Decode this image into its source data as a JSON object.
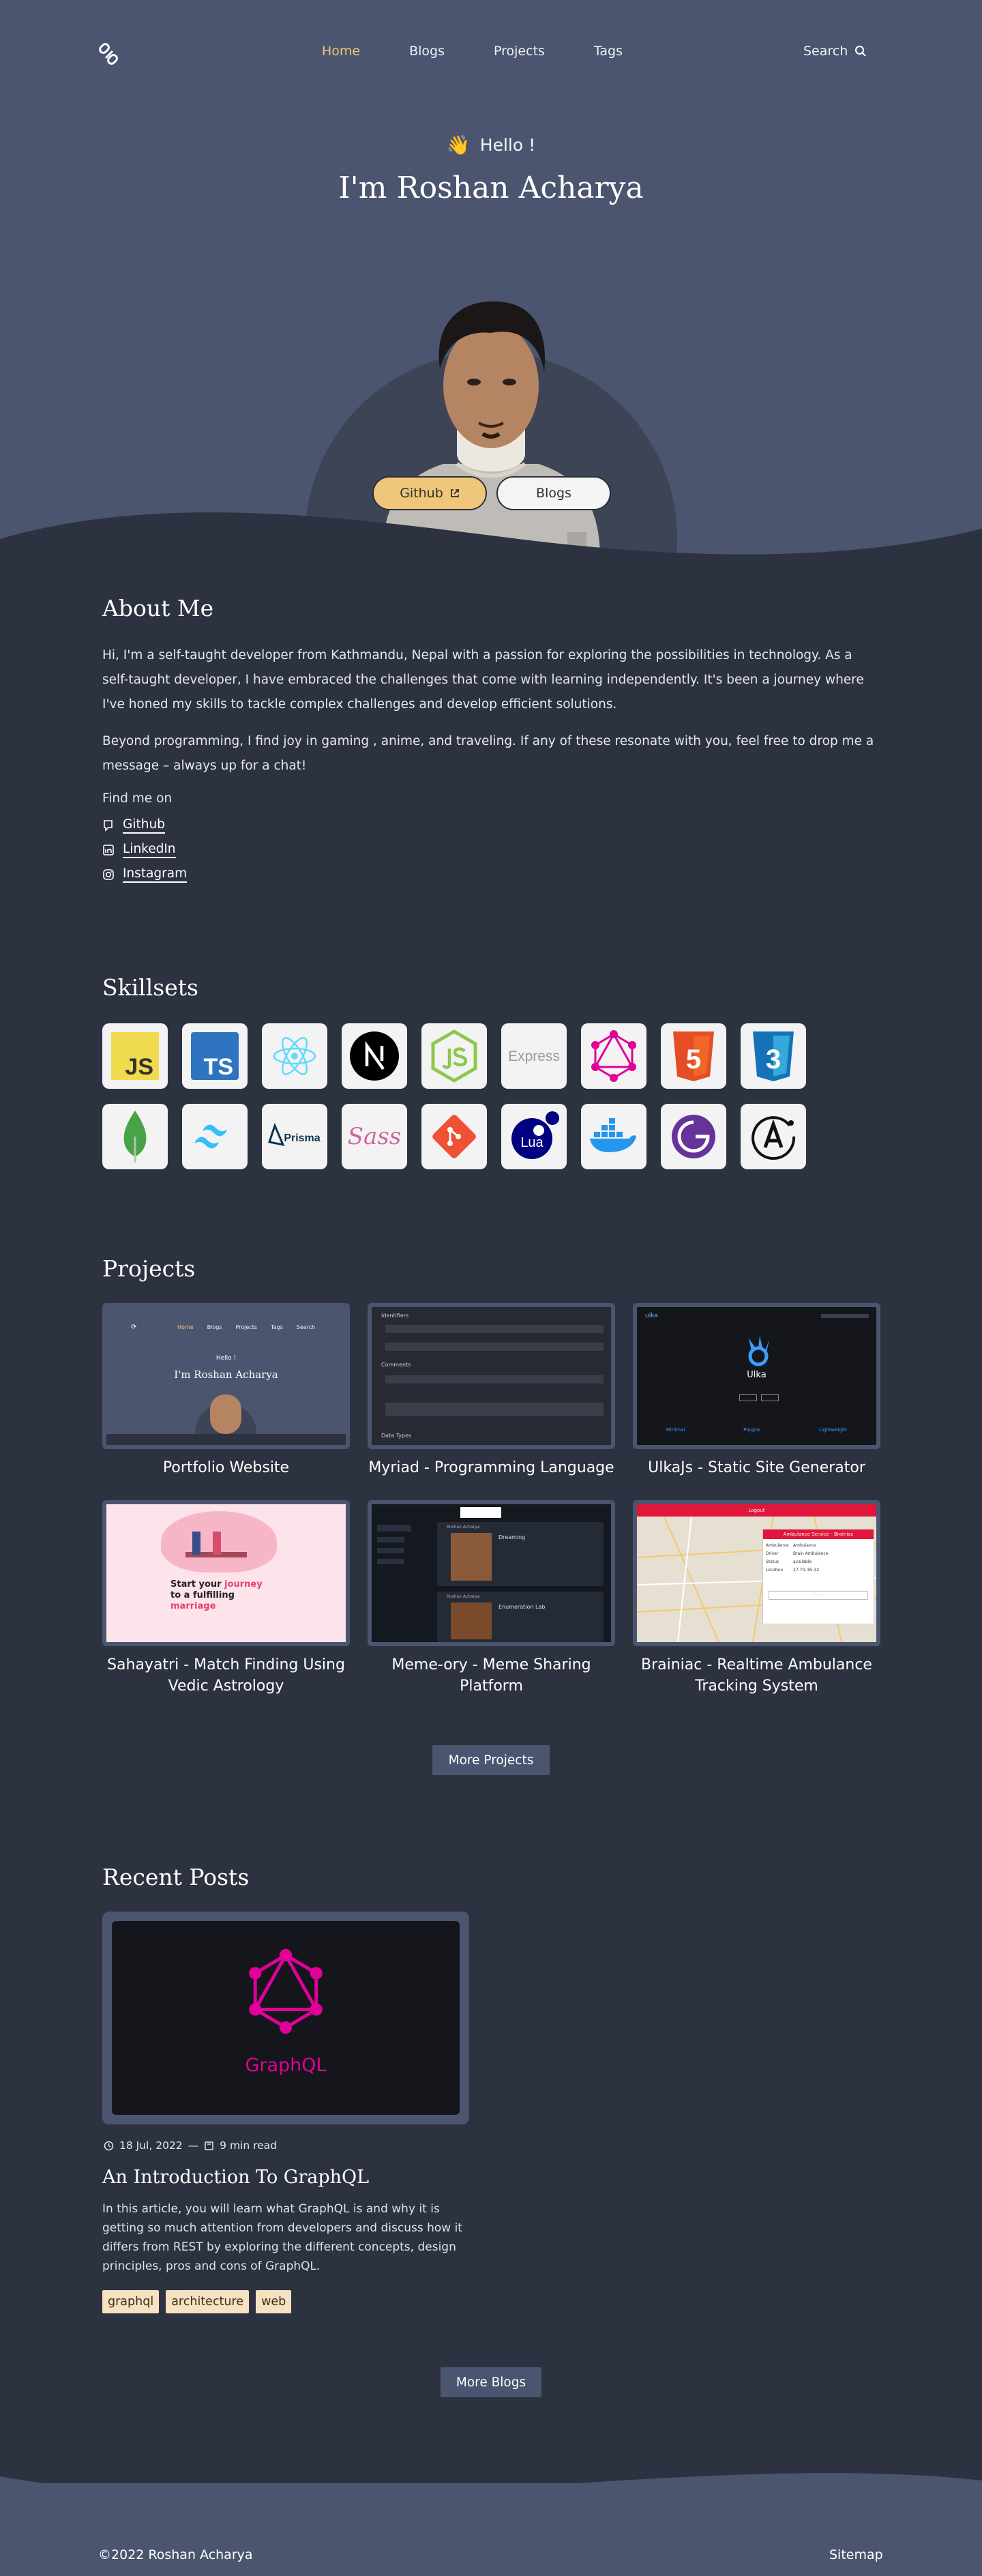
{
  "nav": {
    "links": [
      {
        "label": "Home",
        "active": true
      },
      {
        "label": "Blogs",
        "active": false
      },
      {
        "label": "Projects",
        "active": false
      },
      {
        "label": "Tags",
        "active": false
      }
    ],
    "search_label": "Search",
    "logo_icon": "link-logo-icon"
  },
  "hero": {
    "greeting_emoji": "👋",
    "greeting": "Hello !",
    "name": "I'm Roshan Acharya",
    "github_label": "Github",
    "blogs_label": "Blogs",
    "accent_color": "#f0c67a"
  },
  "about": {
    "title": "About Me",
    "paragraphs": [
      "Hi, I'm a self-taught developer from Kathmandu, Nepal with a passion for exploring the possibilities in technology. As a self-taught developer, I have embraced the challenges that come with learning independently. It's been a journey where I've honed my skills to tackle complex challenges and develop efficient solutions.",
      "Beyond programming, I find joy in gaming , anime, and traveling. If any of these resonate with you, feel free to drop me a message – always up for a chat!"
    ],
    "find_me": "Find me on",
    "socials": [
      {
        "label": "Github",
        "icon": "github-icon"
      },
      {
        "label": "LinkedIn",
        "icon": "linkedin-icon"
      },
      {
        "label": "Instagram",
        "icon": "instagram-icon"
      }
    ]
  },
  "skills": {
    "title": "Skillsets",
    "items": [
      "javascript",
      "typescript",
      "react",
      "nextjs",
      "nodejs",
      "express",
      "graphql",
      "html5",
      "css3",
      "mongodb",
      "tailwindcss",
      "prisma",
      "sass",
      "git",
      "lua",
      "docker",
      "gatsby",
      "apollo"
    ],
    "labels": {
      "js": "JS",
      "ts": "TS",
      "express": "Express",
      "prisma": "Prisma",
      "sass": "Sass",
      "lua": "Lua",
      "html": "5",
      "css": "3"
    }
  },
  "projects": {
    "title": "Projects",
    "items": [
      {
        "title": "Portfolio Website"
      },
      {
        "title": "Myriad - Programming Language"
      },
      {
        "title": "UlkaJs - Static Site Generator"
      },
      {
        "title": "Sahayatri - Match Finding Using Vedic Astrology"
      },
      {
        "title": "Meme-ory - Meme Sharing Platform"
      },
      {
        "title": "Brainiac - Realtime Ambulance Tracking System"
      }
    ],
    "thumb_text": {
      "portfolio_nav": [
        "Home",
        "Blogs",
        "Projects",
        "Tags",
        "Search"
      ],
      "portfolio_hello": "Hello !",
      "portfolio_name": "I'm Roshan Acharya",
      "myriad_headings": [
        "Identifiers",
        "Comments",
        "Data Types"
      ],
      "ulka_name": "Ulka",
      "ulka_logo": "ulka",
      "ulka_features": [
        "Minimal",
        "Plugins",
        "Lightweight"
      ],
      "sahayatri_line1": "Start your",
      "sahayatri_highlight": "journey",
      "sahayatri_line2": "to a fulfilling",
      "sahayatri_line3": "marriage",
      "memeory_user": "Roshan Acharya",
      "memeory_caption": "Dreaming",
      "memeory_user2": "Enumeration Lab",
      "brainiac_header": "Logout",
      "brainiac_panel_title": "Ambulance Service - Brainiac",
      "brainiac_fields": [
        "Ambulance",
        "Driver",
        "Status",
        "Location"
      ],
      "brainiac_values": [
        "Ambulance",
        "Brain Ambulance",
        "available",
        "27.70, 85.32"
      ],
      "brainiac_button": "Book"
    },
    "more_label": "More Projects"
  },
  "posts": {
    "title": "Recent Posts",
    "items": [
      {
        "date": "18 Jul, 2022",
        "read_time": "9 min read",
        "title": "An Introduction To GraphQL",
        "cover_label": "GraphQL",
        "excerpt": "In this article, you will learn what GraphQL is and why it is getting so much attention from developers and discuss how it differs from REST by exploring the different concepts, design principles, pros and cons of GraphQL.",
        "tags": [
          "graphql",
          "architecture",
          "web"
        ]
      }
    ],
    "more_label": "More Blogs"
  },
  "footer": {
    "copyright": "©2022 Roshan Acharya",
    "sitemap": "Sitemap"
  }
}
